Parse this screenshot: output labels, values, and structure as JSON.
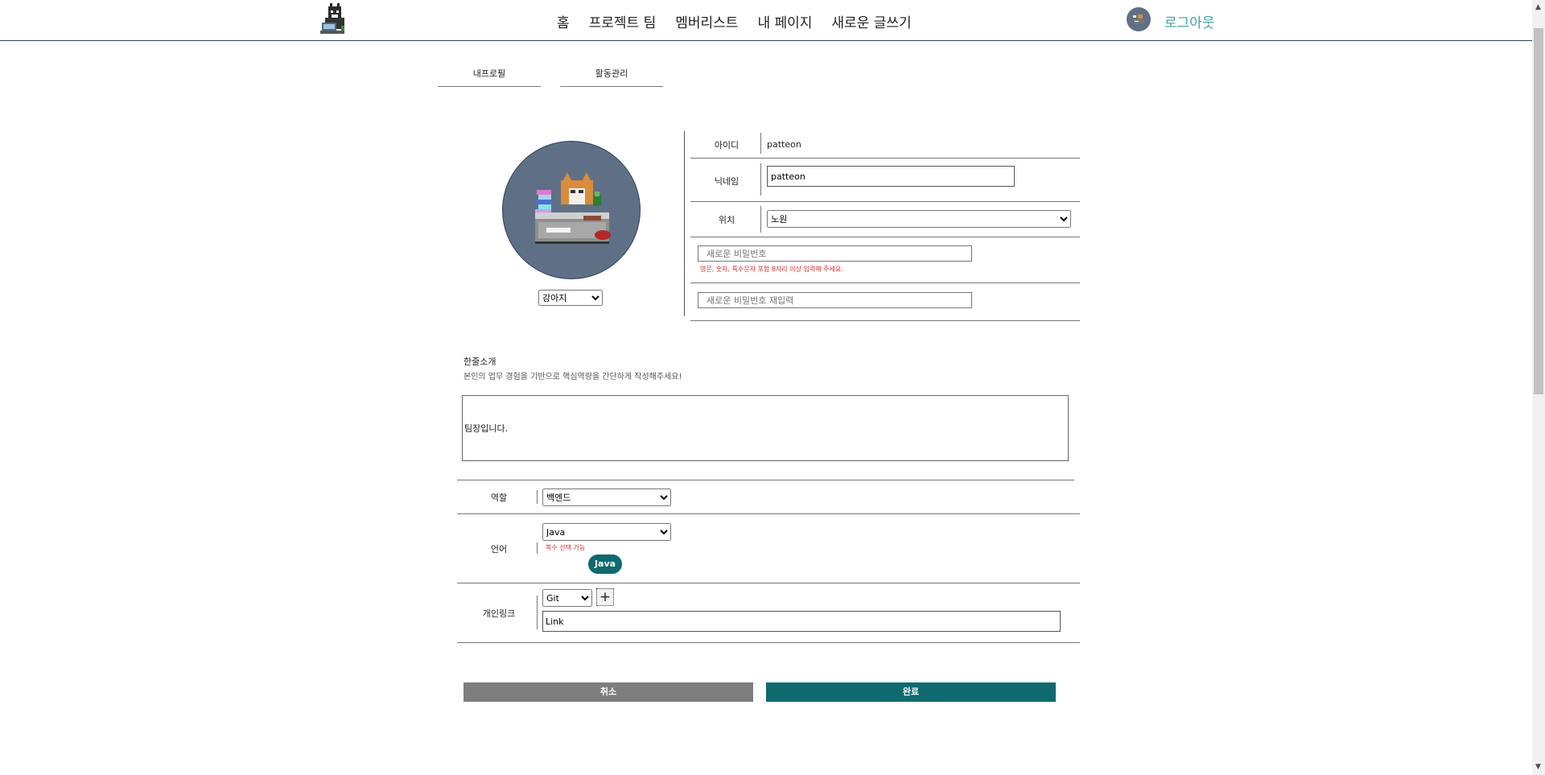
{
  "header": {
    "nav": [
      "홈",
      "프로젝트 팀",
      "멤버리스트",
      "내 페이지",
      "새로운 글쓰기"
    ],
    "logout": "로그아웃",
    "logo_icon": "cat-logo-icon",
    "avatar_icon": "user-avatar-icon"
  },
  "tabs": {
    "profile": "내프로필",
    "activity": "활동관리"
  },
  "avatar": {
    "selected_animal": "강아지",
    "icon": "cat-at-desk-icon"
  },
  "form": {
    "id_label": "아이디",
    "id_value": "patteon",
    "nickname_label": "닉네임",
    "nickname_value": "patteon",
    "location_label": "위치",
    "location_value": "노원",
    "new_password_placeholder": "새로운 비밀번호",
    "password_hint": "영문, 숫자, 특수문자 포함 8자리 이상 입력해 주세요.",
    "confirm_password_placeholder": "새로운 비밀번호 재입력"
  },
  "intro": {
    "title": "한줄소개",
    "description": "본인의 업무 경험을 기반으로 핵심역량을 간단하게 작성해주세요!",
    "value": "팀장입니다."
  },
  "role": {
    "label": "역할",
    "value": "백엔드"
  },
  "language": {
    "label": "언어",
    "value": "Java",
    "hint": "복수 선택 가능",
    "chips": [
      "Java"
    ]
  },
  "link": {
    "label": "개인링크",
    "type": "Git",
    "add": "+",
    "value": "Link"
  },
  "buttons": {
    "cancel": "취소",
    "done": "완료"
  },
  "colors": {
    "primary": "#0e6a6e",
    "avatar_bg": "#5f7086",
    "logout": "#3aa6a0",
    "error": "#d62a2a",
    "cancel": "#7e7e7e"
  }
}
